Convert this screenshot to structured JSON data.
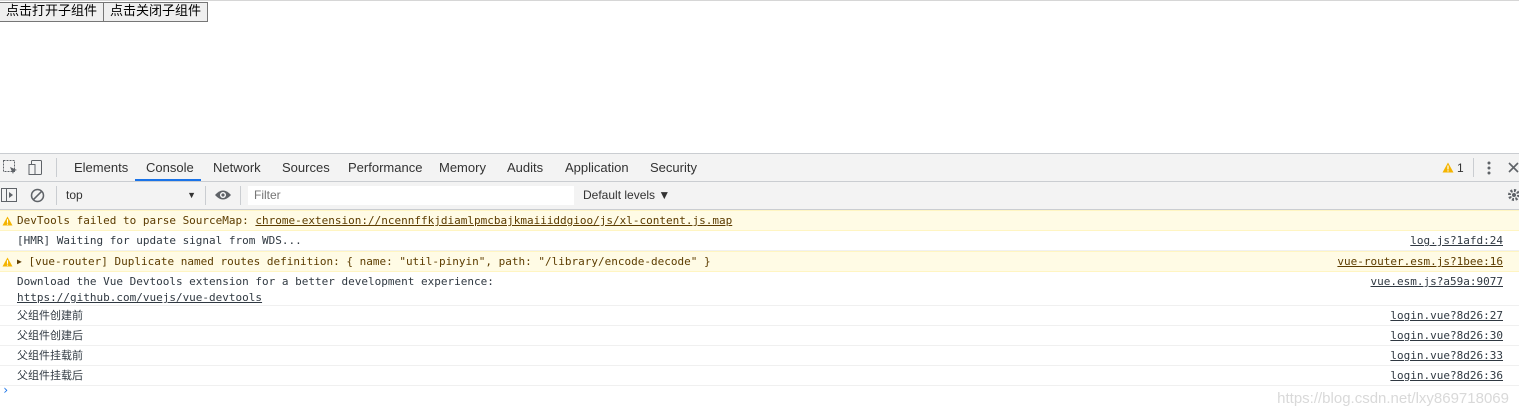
{
  "page": {
    "open_button": "点击打开子组件",
    "close_button": "点击关闭子组件"
  },
  "devtools": {
    "tabs": [
      "Elements",
      "Console",
      "Network",
      "Sources",
      "Performance",
      "Memory",
      "Audits",
      "Application",
      "Security"
    ],
    "active_tab": "Console",
    "warning_count": "1",
    "context": "top",
    "filter_placeholder": "Filter",
    "levels": "Default levels ▼"
  },
  "console": {
    "messages": [
      {
        "level": "warning",
        "text": "DevTools failed to parse SourceMap: ",
        "link": "chrome-extension://ncennffkjdiamlpmcbajkmaiiiddgioo/js/xl-content.js.map",
        "source": ""
      },
      {
        "level": "info",
        "text": "[HMR] Waiting for update signal from WDS...",
        "link": "",
        "source": "log.js?1afd:24"
      },
      {
        "level": "warning",
        "text": "[vue-router] Duplicate named routes definition: { name: \"util-pinyin\", path: \"/library/encode-decode\" }",
        "link": "",
        "source": "vue-router.esm.js?1bee:16"
      },
      {
        "level": "info",
        "text": "Download the Vue Devtools extension for a better development experience:",
        "link": "https://github.com/vuejs/vue-devtools",
        "source": "vue.esm.js?a59a:9077"
      },
      {
        "level": "info",
        "text": "父组件创建前",
        "link": "",
        "source": "login.vue?8d26:27"
      },
      {
        "level": "info",
        "text": "父组件创建后",
        "link": "",
        "source": "login.vue?8d26:30"
      },
      {
        "level": "info",
        "text": "父组件挂载前",
        "link": "",
        "source": "login.vue?8d26:33"
      },
      {
        "level": "info",
        "text": "父组件挂载后",
        "link": "",
        "source": "login.vue?8d26:36"
      }
    ],
    "prompt": "›"
  },
  "watermark": "https://blog.csdn.net/lxy869718069",
  "colors": {
    "accent": "#1a73e8",
    "warning_bg": "#fffbe5",
    "warning_text": "#5c3c00"
  }
}
